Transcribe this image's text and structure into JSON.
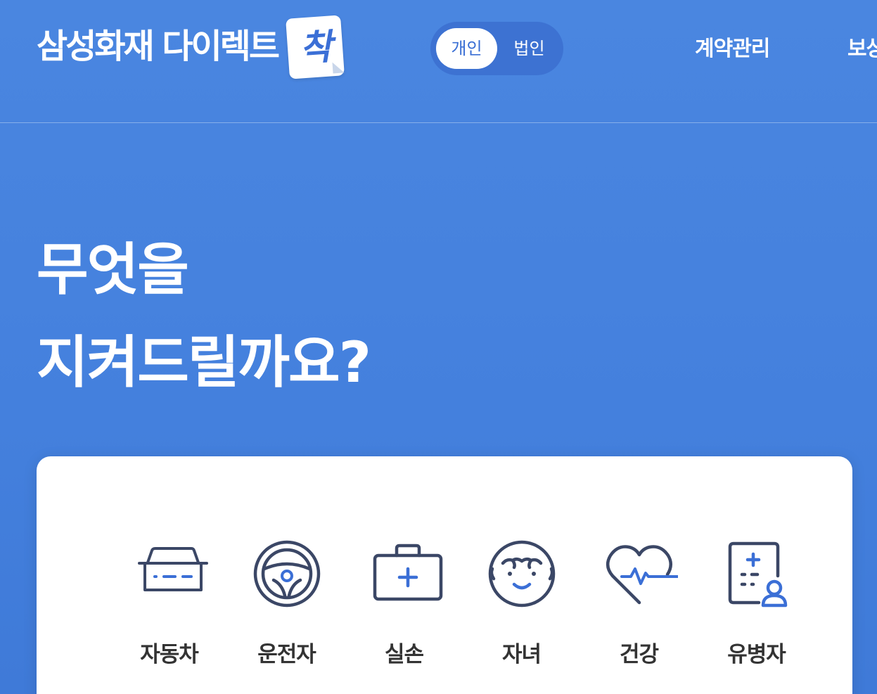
{
  "header": {
    "logo_text": "삼성화재 다이렉트",
    "logo_badge": "착",
    "toggle": {
      "active_label": "개인",
      "inactive_label": "법인"
    },
    "nav": [
      {
        "label": "계약관리"
      },
      {
        "label": "보상"
      }
    ]
  },
  "hero": {
    "line1": "무엇을",
    "line2": "지켜드릴까요?"
  },
  "categories": [
    {
      "label": "자동차",
      "icon": "car-icon"
    },
    {
      "label": "운전자",
      "icon": "steering-wheel-icon"
    },
    {
      "label": "실손",
      "icon": "first-aid-kit-icon"
    },
    {
      "label": "자녀",
      "icon": "child-face-icon"
    },
    {
      "label": "건강",
      "icon": "heart-pulse-icon"
    },
    {
      "label": "유병자",
      "icon": "medical-chart-person-icon"
    }
  ],
  "colors": {
    "background": "#4a86e0",
    "icon_stroke": "#3b4766",
    "icon_accent": "#3b6fd6",
    "panel": "#ffffff"
  }
}
